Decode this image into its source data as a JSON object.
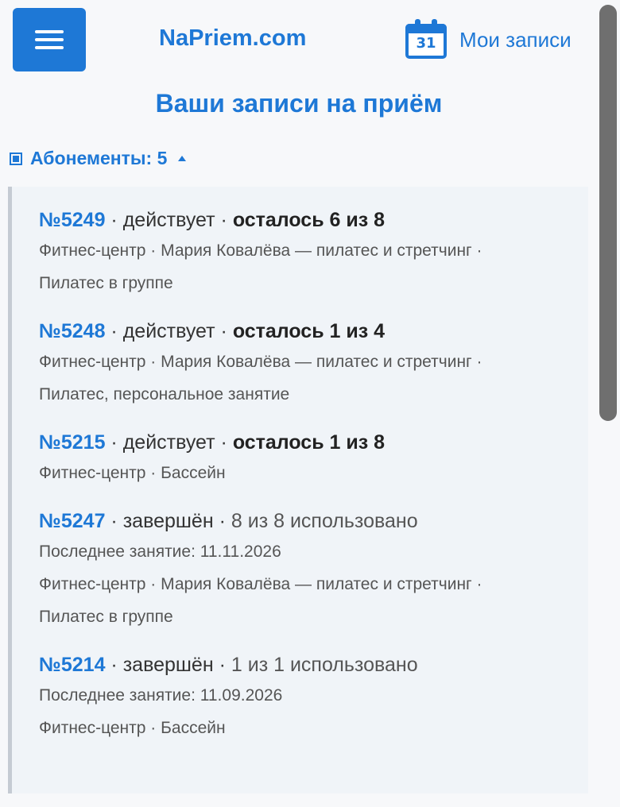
{
  "header": {
    "site_name": "NaPriem.com",
    "calendar_day": "31",
    "my_records_label": "Мои записи"
  },
  "page_title": "Ваши записи на приём",
  "subscriptions": {
    "toggle_label": "Абонементы: 5",
    "items": [
      {
        "number": "№5249",
        "sep1": " · ",
        "status": "действует",
        "sep2": " · ",
        "remaining": "осталось 6 из 8",
        "used": "",
        "last_session": "",
        "details": "Фитнес-центр · Мария Ковалёва — пилатес и стретчинг · Пилатес в группе"
      },
      {
        "number": "№5248",
        "sep1": " · ",
        "status": "действует",
        "sep2": " · ",
        "remaining": "осталось 1 из 4",
        "used": "",
        "last_session": "",
        "details": "Фитнес-центр · Мария Ковалёва — пилатес и стретчинг · Пилатес, персональное занятие"
      },
      {
        "number": "№5215",
        "sep1": " · ",
        "status": "действует",
        "sep2": " · ",
        "remaining": "осталось 1 из 8",
        "used": "",
        "last_session": "",
        "details": "Фитнес-центр · Бассейн"
      },
      {
        "number": "№5247",
        "sep1": " · ",
        "status": "завершён",
        "sep2": " · ",
        "remaining": "",
        "used": "8 из 8 использовано",
        "last_session": "Последнее занятие: 11.11.2026",
        "details": "Фитнес-центр · Мария Ковалёва — пилатес и стретчинг · Пилатес в группе"
      },
      {
        "number": "№5214",
        "sep1": " · ",
        "status": "завершён",
        "sep2": " · ",
        "remaining": "",
        "used": "1 из 1 использовано",
        "last_session": "Последнее занятие: 11.09.2026",
        "details": "Фитнес-центр · Бассейн"
      }
    ]
  },
  "colors": {
    "accent": "#1e78d6",
    "list_background": "#f0f4f8",
    "list_border": "#c5cbd3"
  }
}
